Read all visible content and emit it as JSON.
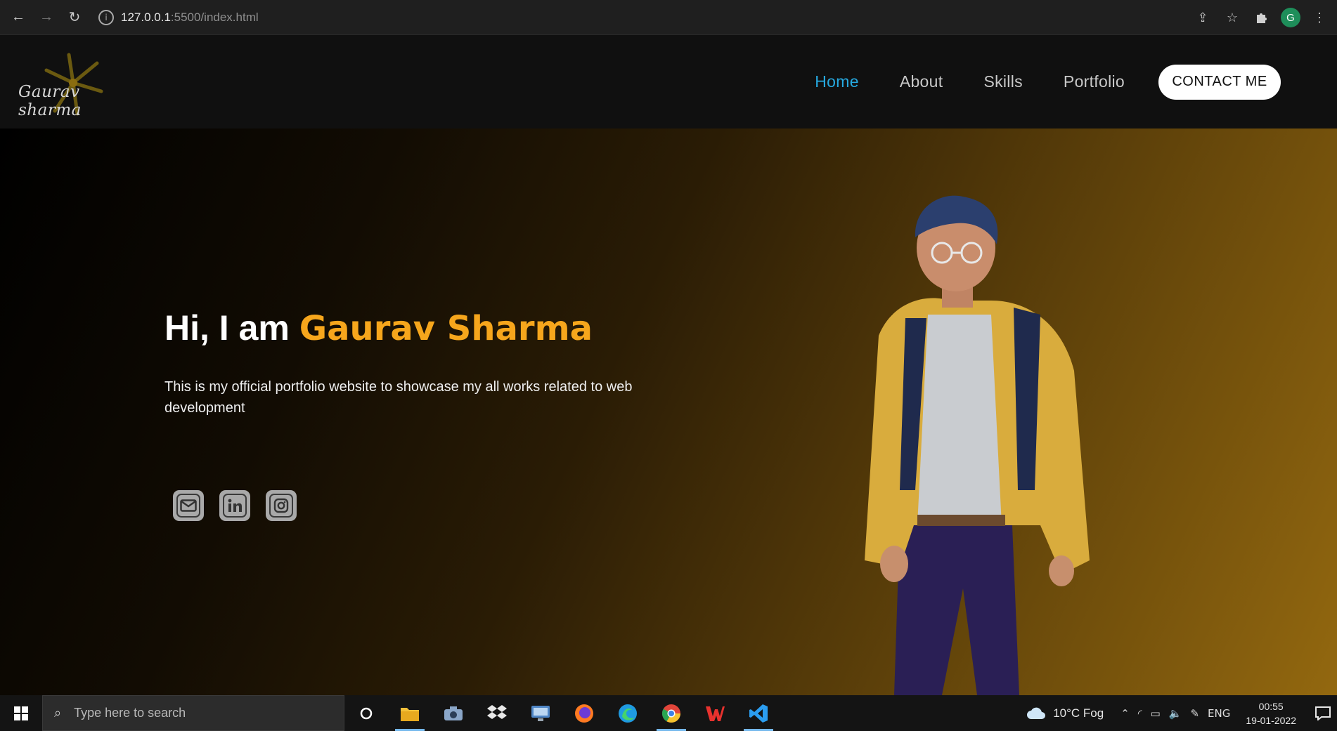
{
  "browser": {
    "url_host": "127.0.0.1",
    "url_path": ":5500/index.html",
    "profile_initial": "G"
  },
  "site": {
    "logo_text": "Gaurav sharma",
    "nav": [
      {
        "label": "Home",
        "active": true
      },
      {
        "label": "About",
        "active": false
      },
      {
        "label": "Skills",
        "active": false
      },
      {
        "label": "Portfolio",
        "active": false
      }
    ],
    "contact_label": "CONTACT ME"
  },
  "hero": {
    "greeting": "Hi, I am ",
    "name": "Gaurav Sharma",
    "description": "This is my official portfolio website to showcase my all works related to web development",
    "socials": [
      {
        "icon": "mail-icon"
      },
      {
        "icon": "linkedin-icon"
      },
      {
        "icon": "instagram-icon"
      }
    ]
  },
  "taskbar": {
    "search_placeholder": "Type here to search",
    "weather": "10°C  Fog",
    "language": "ENG",
    "time": "00:55",
    "date": "19-01-2022"
  },
  "colors": {
    "accent_nav": "#26a9e0",
    "name_highlight": "#f6a61c"
  }
}
